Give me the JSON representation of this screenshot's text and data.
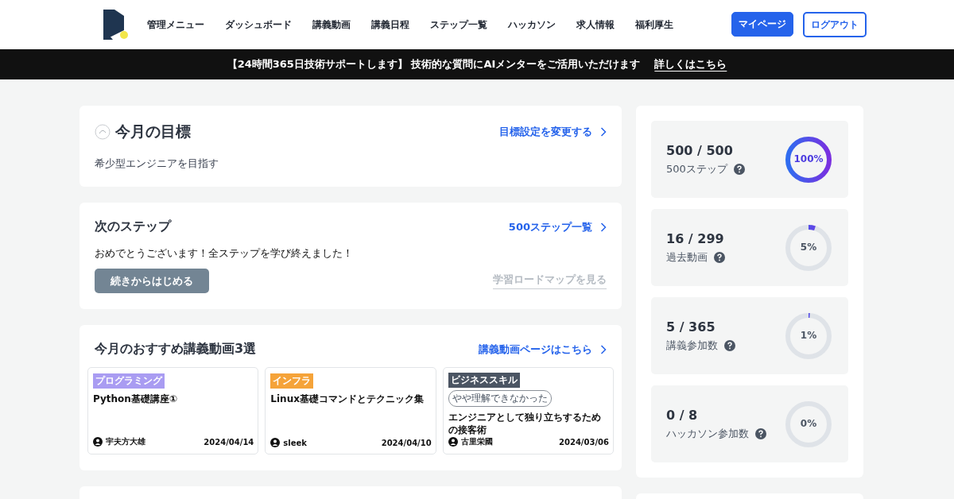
{
  "nav": {
    "items": [
      "管理メニュー",
      "ダッシュボード",
      "講義動画",
      "講義日程",
      "ステップ一覧",
      "ハッカソン",
      "求人情報",
      "福利厚生"
    ],
    "buttons": [
      {
        "label": "マイページ",
        "kind": "primary"
      },
      {
        "label": "ログアウト",
        "kind": "outline"
      }
    ]
  },
  "banner": {
    "text": "【24時間365日技術サポートします】 技術的な質問にAIメンターをご活用いただけます",
    "link": "詳しくはこちら"
  },
  "goal": {
    "title": "今月の目標",
    "link": "目標設定を変更する",
    "text": "希少型エンジニアを目指す"
  },
  "next_step": {
    "title": "次のステップ",
    "link": "500ステップ一覧",
    "message": "おめでとうございます！全ステップを学び終えました！",
    "button": "続きからはじめる",
    "roadmap_link": "学習ロードマップを見る"
  },
  "videos": {
    "title": "今月のおすすめ講義動画3選",
    "link": "講義動画ページはこちら",
    "items": [
      {
        "tag": "プログラミング",
        "color": "#a99cf2",
        "title": "Python基礎講座①",
        "author": "宇夫方大雄",
        "date": "2024/04/14"
      },
      {
        "tag": "インフラ",
        "color": "#f5a339",
        "title": "Linux基礎コマンドとテクニック集",
        "author": "sleek",
        "date": "2024/04/10"
      },
      {
        "tag": "ビジネススキル",
        "color": "#4b5563",
        "title": "エンジニアとして独り立ちするための接客術",
        "author": "古里栄國",
        "date": "2024/03/06",
        "badge": "やや理解できなかった"
      }
    ]
  },
  "stats": [
    {
      "value": "500 / 500",
      "label": "500ステップ",
      "percent": "100%",
      "level": 1
    },
    {
      "value": "16 / 299",
      "label": "過去動画",
      "percent": "5%",
      "level": 0.05
    },
    {
      "value": "5 / 365",
      "label": "講義参加数",
      "percent": "1%",
      "level": 0.01
    },
    {
      "value": "0 / 8",
      "label": "ハッカソン参加数",
      "percent": "0%",
      "level": 0
    }
  ]
}
